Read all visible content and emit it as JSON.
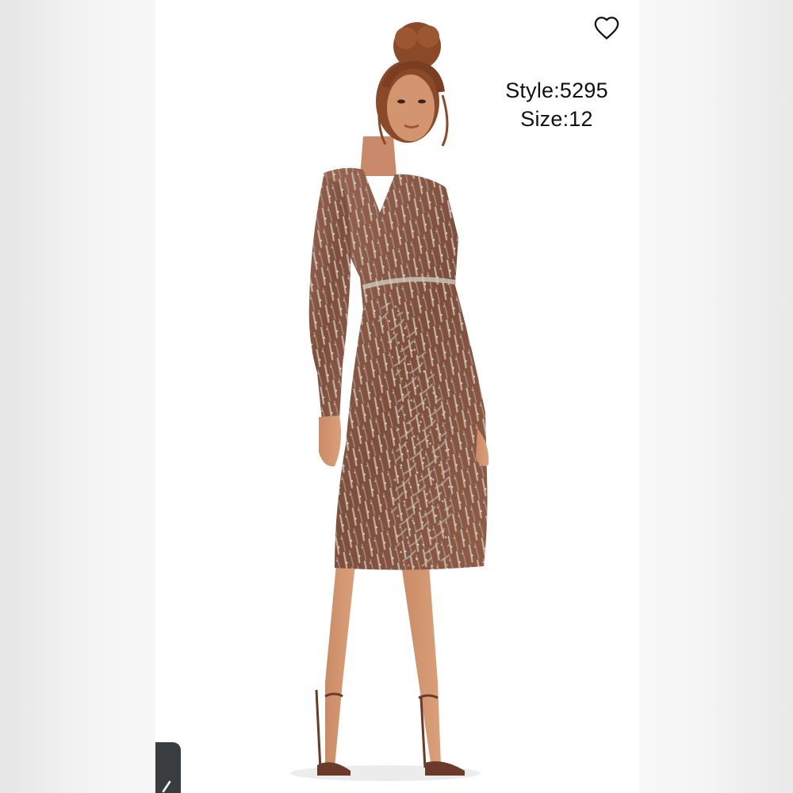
{
  "listing": {
    "style_text": "Style:5295",
    "size_text": "Size:12"
  },
  "photo": {
    "subject": "model in long-sleeve embellished sequin midi dress",
    "dress_color": "#8a5a44",
    "sequin_color": "#b8b2a8"
  },
  "icons": {
    "favorite": "heart-outline-icon",
    "corner": "chevron-icon"
  },
  "colors": {
    "background": "#f5f5f5",
    "card": "#ffffff",
    "text": "#111111",
    "corner_tab": "#3a3d3f"
  }
}
